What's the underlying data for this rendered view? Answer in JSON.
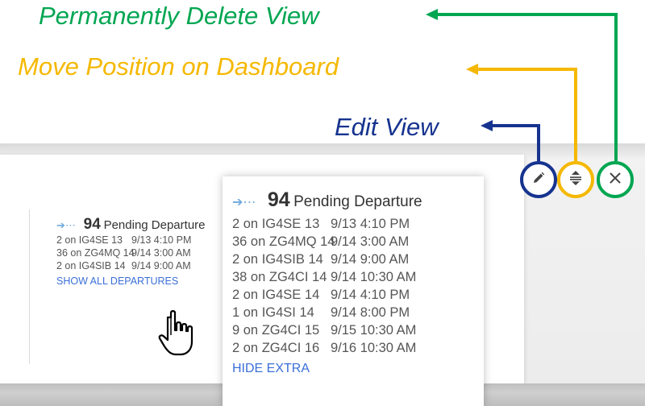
{
  "callouts": {
    "delete": "Permanently Delete View",
    "move": "Move Position on Dashboard",
    "edit": "Edit View"
  },
  "colors": {
    "delete": "#00a651",
    "move": "#f5b800",
    "edit": "#16338f",
    "link": "#3a6fd8",
    "arrow_icon": "#6fa9dd"
  },
  "controls": {
    "edit_icon": "pencil-icon",
    "move_icon": "reorder-icon",
    "delete_icon": "close-icon"
  },
  "tile": {
    "count": "94",
    "label": "Pending Departure",
    "icon": "departure-arrow-icon",
    "rows": [
      {
        "flight": "2 on IG4SE 13",
        "time": "9/13 4:10 PM"
      },
      {
        "flight": "36 on ZG4MQ 14",
        "time": "9/14 3:00 AM"
      },
      {
        "flight": "2 on IG4SIB 14",
        "time": "9/14 9:00 AM"
      }
    ],
    "show_all": "SHOW ALL DEPARTURES"
  },
  "popup": {
    "count": "94",
    "label": "Pending Departure",
    "icon": "departure-arrow-icon",
    "rows": [
      {
        "flight": "2 on IG4SE 13",
        "time": "9/13 4:10 PM"
      },
      {
        "flight": "36 on ZG4MQ 14",
        "time": "9/14 3:00 AM"
      },
      {
        "flight": "2 on IG4SIB 14",
        "time": "9/14 9:00 AM"
      },
      {
        "flight": "38 on ZG4CI 14",
        "time": "9/14 10:30 AM"
      },
      {
        "flight": "2 on IG4SE 14",
        "time": "9/14 4:10 PM"
      },
      {
        "flight": "1 on IG4SI 14",
        "time": "9/14 8:00 PM"
      },
      {
        "flight": "9 on ZG4CI 15",
        "time": "9/15 10:30 AM"
      },
      {
        "flight": "2 on ZG4CI 16",
        "time": "9/16 10:30 AM"
      }
    ],
    "hide": "HIDE EXTRA"
  }
}
